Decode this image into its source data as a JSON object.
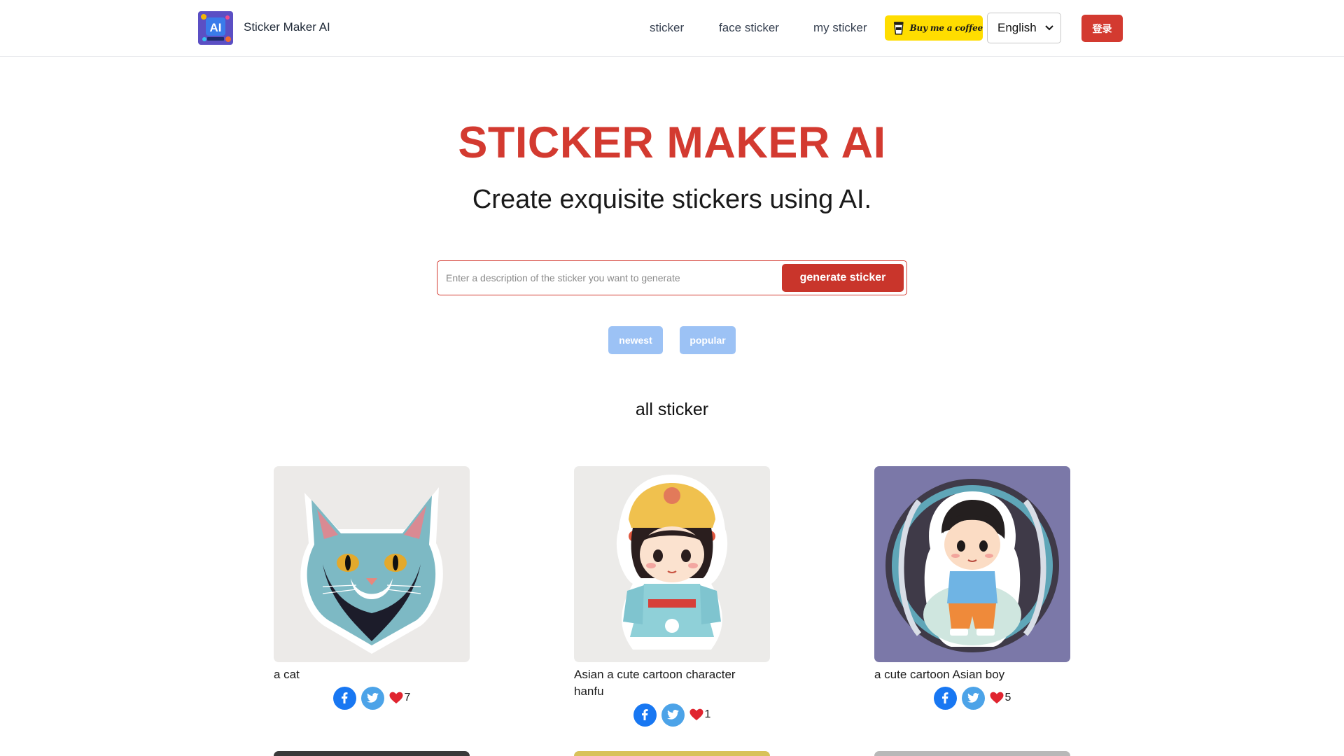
{
  "header": {
    "brand": "Sticker Maker AI",
    "logo_text": "AI",
    "nav": [
      {
        "label": "sticker"
      },
      {
        "label": "face sticker"
      },
      {
        "label": "my sticker"
      }
    ],
    "coffee_label": "Buy me a coffee",
    "language": "English",
    "login_label": "登录"
  },
  "hero": {
    "title": "STICKER MAKER AI",
    "subtitle": "Create exquisite stickers using AI."
  },
  "search": {
    "placeholder": "Enter a description of the sticker you want to generate",
    "value": "",
    "button_label": "generate sticker"
  },
  "filters": {
    "newest": "newest",
    "popular": "popular"
  },
  "section_title": "all sticker",
  "cards": [
    {
      "caption": "a cat",
      "likes": "7"
    },
    {
      "caption": "Asian a cute cartoon character hanfu",
      "likes": "1"
    },
    {
      "caption": "a cute cartoon Asian boy",
      "likes": "5"
    }
  ],
  "colors": {
    "accent": "#d33a30",
    "pill": "#9cc2f5",
    "coffee": "#ffdd00",
    "facebook": "#1877f2",
    "twitter": "#4ca3e8"
  }
}
